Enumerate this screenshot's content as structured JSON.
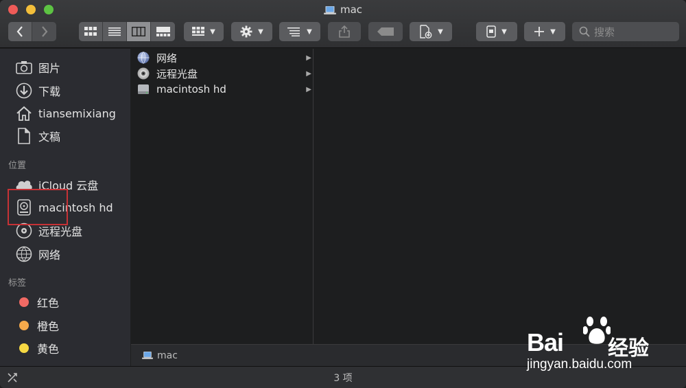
{
  "window": {
    "title": "mac"
  },
  "toolbar": {
    "search_placeholder": "搜索"
  },
  "sidebar": {
    "favorites": [
      {
        "label": "图片",
        "icon": "camera-icon"
      },
      {
        "label": "下载",
        "icon": "download-icon"
      },
      {
        "label": "tiansemixiang",
        "icon": "home-icon"
      },
      {
        "label": "文稿",
        "icon": "document-icon"
      }
    ],
    "locations_header": "位置",
    "locations": [
      {
        "label": "iCloud 云盘",
        "icon": "cloud-icon"
      },
      {
        "label": "macintosh hd",
        "icon": "harddisk-icon"
      },
      {
        "label": "远程光盘",
        "icon": "disc-icon"
      },
      {
        "label": "网络",
        "icon": "network-globe-icon"
      }
    ],
    "tags_header": "标签",
    "tags": [
      {
        "label": "红色",
        "color": "#f16a64"
      },
      {
        "label": "橙色",
        "color": "#f5a94b"
      },
      {
        "label": "黄色",
        "color": "#f6d843"
      }
    ]
  },
  "browser": {
    "column1": [
      {
        "label": "网络",
        "icon": "network-globe-icon"
      },
      {
        "label": "远程光盘",
        "icon": "disc-icon"
      },
      {
        "label": "macintosh hd",
        "icon": "harddisk-icon"
      }
    ]
  },
  "pathbar": {
    "label": "mac"
  },
  "status": {
    "text": "3 项"
  },
  "watermark": {
    "brand": "Bai",
    "brand_suffix": "经验",
    "url": "jingyan.baidu.com"
  }
}
